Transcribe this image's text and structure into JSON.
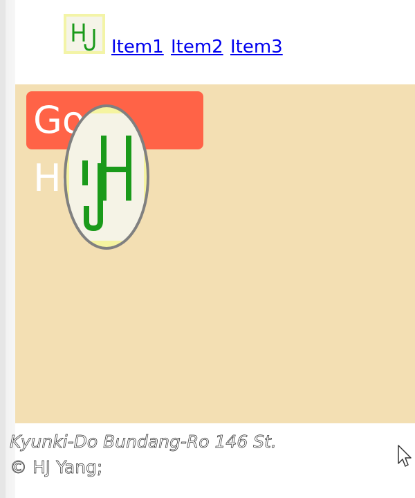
{
  "header": {
    "logo_text": "HJ",
    "nav": [
      {
        "label": "Item1"
      },
      {
        "label": "Item2"
      },
      {
        "label": "Item3"
      }
    ]
  },
  "main": {
    "go_home_label": "Go Home",
    "logo_text": "HJ"
  },
  "footer": {
    "address": "Kyunki-Do Bundang-Ro 146 St.",
    "copyright": "© HJ Yang;"
  },
  "colors": {
    "main_bg": "#f3dfb3",
    "button_bg": "#ff6347",
    "logo_bg": "#f3f4a7",
    "logo_green": "#1a9a1a",
    "link": "#0000ee"
  }
}
